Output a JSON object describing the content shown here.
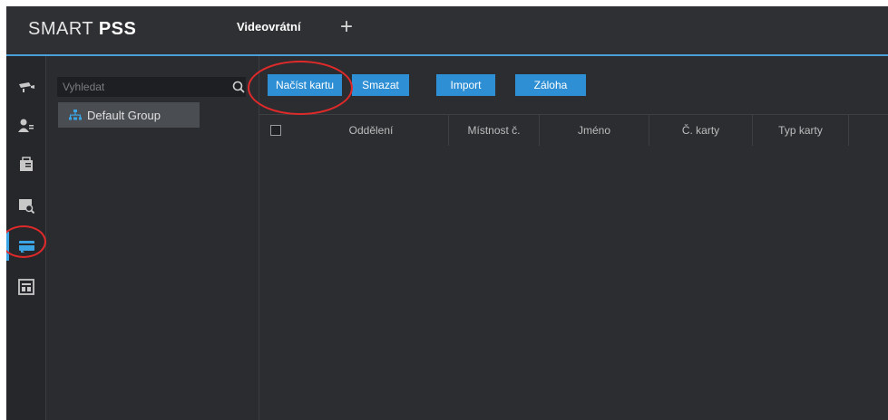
{
  "header": {
    "logo_light": "SMART ",
    "logo_bold": "PSS",
    "active_tab": "Videovrátní",
    "add_tab_symbol": "+"
  },
  "sidebar_icons": [
    {
      "name": "camera-icon",
      "active": false
    },
    {
      "name": "user-icon",
      "active": false
    },
    {
      "name": "access-card-icon",
      "active": false
    },
    {
      "name": "search-record-icon",
      "active": false
    },
    {
      "name": "card-issue-icon",
      "active": true
    },
    {
      "name": "dashboard-icon",
      "active": false
    }
  ],
  "group_panel": {
    "search_placeholder": "Vyhledat",
    "groups": [
      "Default Group"
    ]
  },
  "toolbar": {
    "read_card": "Načíst kartu",
    "delete": "Smazat",
    "import": "Import",
    "backup": "Záloha"
  },
  "table": {
    "columns": [
      "Oddělení",
      "Místnost č.",
      "Jméno",
      "Č. karty",
      "Typ karty"
    ],
    "rows": []
  },
  "colors": {
    "accent": "#2e8fd4",
    "annotation": "#e02a2a",
    "background": "#2b2d31"
  }
}
